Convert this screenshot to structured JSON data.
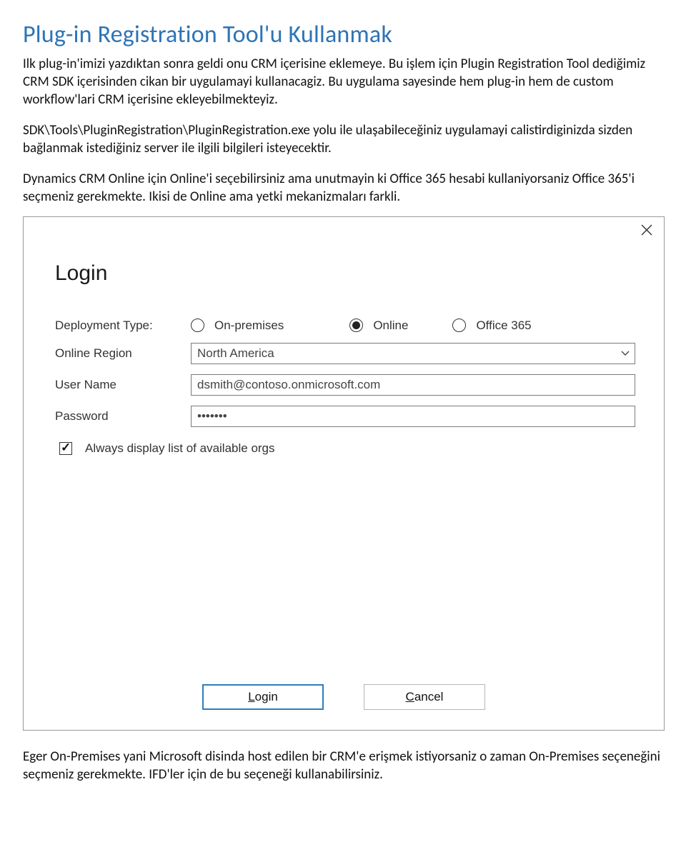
{
  "article": {
    "heading": "Plug-in Registration Tool'u Kullanmak",
    "p1": "Ilk plug-in'imizi yazdıktan sonra geldi onu CRM içerisine eklemeye. Bu işlem için Plugin Registration Tool dediğimiz CRM SDK içerisinden cikan bir uygulamayi kullanacagiz. Bu uygulama sayesinde hem plug-in hem de custom workflow'lari CRM içerisine ekleyebilmekteyiz.",
    "p2": "SDK\\Tools\\PluginRegistration\\PluginRegistration.exe yolu ile ulaşabileceğiniz uygulamayi calistirdiginizda sizden bağlanmak istediğiniz server ile ilgili bilgileri isteyecektir.",
    "p3": "Dynamics CRM Online için Online'i seçebilirsiniz ama unutmayin ki Office 365 hesabi kullaniyorsaniz Office 365'i seçmeniz gerekmekte. Ikisi de Online ama yetki mekanizmaları farkli.",
    "p4": "Eger On-Premises yani Microsoft disinda host edilen bir CRM'e erişmek istiyorsaniz o zaman On-Premises seçeneğini seçmeniz gerekmekte. IFD'ler için de bu seçeneği kullanabilirsiniz."
  },
  "dialog": {
    "title": "Login",
    "labels": {
      "deployment": "Deployment Type:",
      "region": "Online Region",
      "username": "User Name",
      "password": "Password"
    },
    "deployment_options": {
      "onprem": "On-premises",
      "online": "Online",
      "office365": "Office 365",
      "selected": "online"
    },
    "region_selected": "North America",
    "username_value": "dsmith@contoso.onmicrosoft.com",
    "password_value": "•••••••",
    "checkbox_label": "Always display list of available orgs",
    "checkbox_checked": true,
    "buttons": {
      "login_accel": "L",
      "login_rest": "ogin",
      "cancel_accel": "C",
      "cancel_rest": "ancel"
    }
  }
}
